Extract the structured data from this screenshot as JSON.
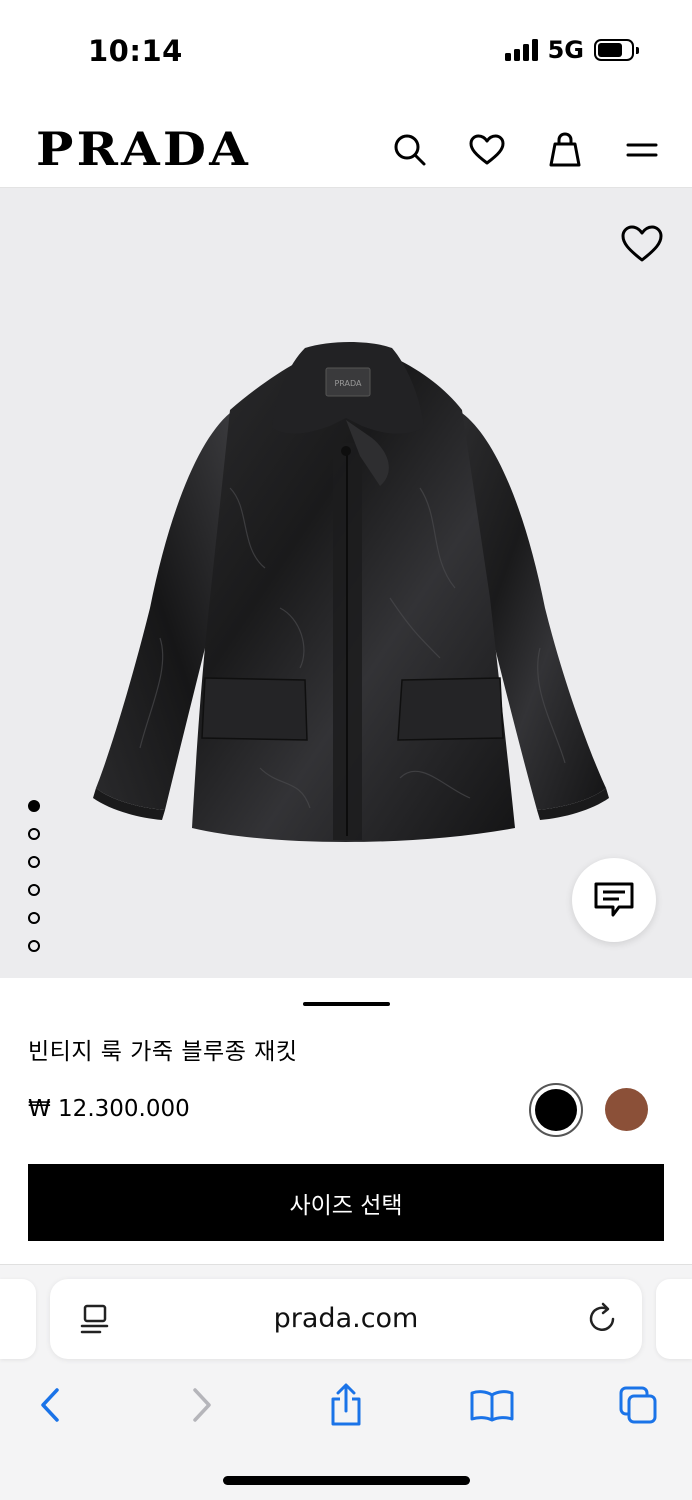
{
  "status_bar": {
    "time": "10:14",
    "network": "5G"
  },
  "header": {
    "logo": "PRADA",
    "icons": [
      "search-icon",
      "heart-icon",
      "bag-icon",
      "menu-icon"
    ]
  },
  "gallery": {
    "total_images": 6,
    "active_index": 0,
    "wishlist_icon": "heart-icon",
    "chat_icon": "chat-bubble-icon"
  },
  "product": {
    "name": "빈티지 룩 가죽 블루종 재킷",
    "price": "₩ 12.300.000",
    "colors": [
      {
        "hex": "#000000",
        "selected": true
      },
      {
        "hex": "#8B5038",
        "selected": false
      }
    ],
    "select_size_label": "사이즈 선택"
  },
  "browser": {
    "url": "prada.com",
    "toolbar_icons": [
      "back-icon",
      "forward-icon",
      "share-icon",
      "bookmarks-icon",
      "tabs-icon"
    ],
    "accent_color": "#1a73e8"
  }
}
